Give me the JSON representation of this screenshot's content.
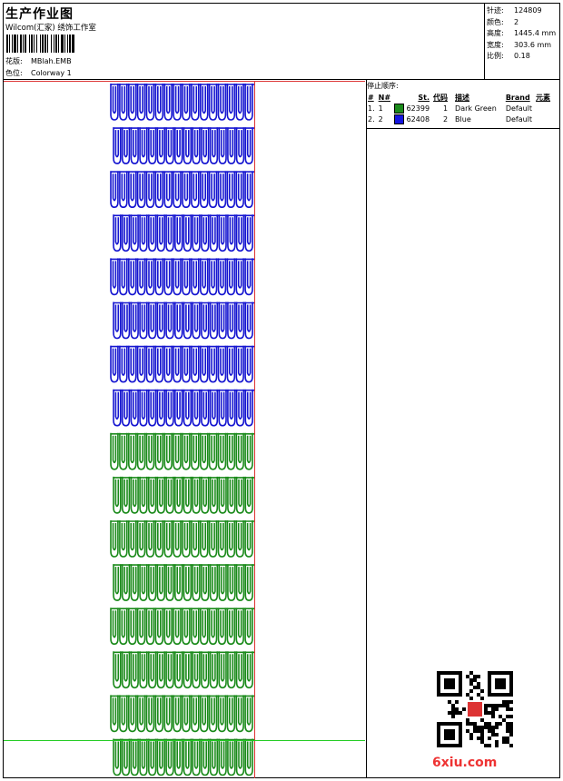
{
  "header": {
    "title": "生产作业图",
    "subtitle": "Wilcom(汇家) 绣饰工作室",
    "design_label": "花版:",
    "design_value": "MBlah.EMB",
    "colorway_label": "色位:",
    "colorway_value": "Colorway 1"
  },
  "stats": [
    {
      "label": "针迹:",
      "value": "124809"
    },
    {
      "label": "颜色:",
      "value": "2"
    },
    {
      "label": "高度:",
      "value": "1445.4 mm"
    },
    {
      "label": "宽度:",
      "value": "303.6 mm"
    },
    {
      "label": "比例:",
      "value": "0.18"
    }
  ],
  "stop_sequence": {
    "title": "停止顺序:",
    "columns": [
      "#",
      "N#",
      "St.",
      "代码",
      "描述",
      "Brand",
      "元素"
    ],
    "rows": [
      {
        "num": "1.",
        "n": "1",
        "color": "#1a8a1a",
        "st": "62399",
        "code": "1",
        "desc": "Dark Green",
        "brand": "Default",
        "elem": ""
      },
      {
        "num": "2.",
        "n": "2",
        "color": "#1515e0",
        "st": "62408",
        "code": "2",
        "desc": "Blue",
        "brand": "Default",
        "elem": ""
      }
    ]
  },
  "design": {
    "blue_rows": 8,
    "green_rows": 8,
    "loops_per_row": 16,
    "blue_color": "#1515d0",
    "green_color": "#1a8a1a"
  },
  "footer": {
    "watermark": "6xiu.com"
  }
}
